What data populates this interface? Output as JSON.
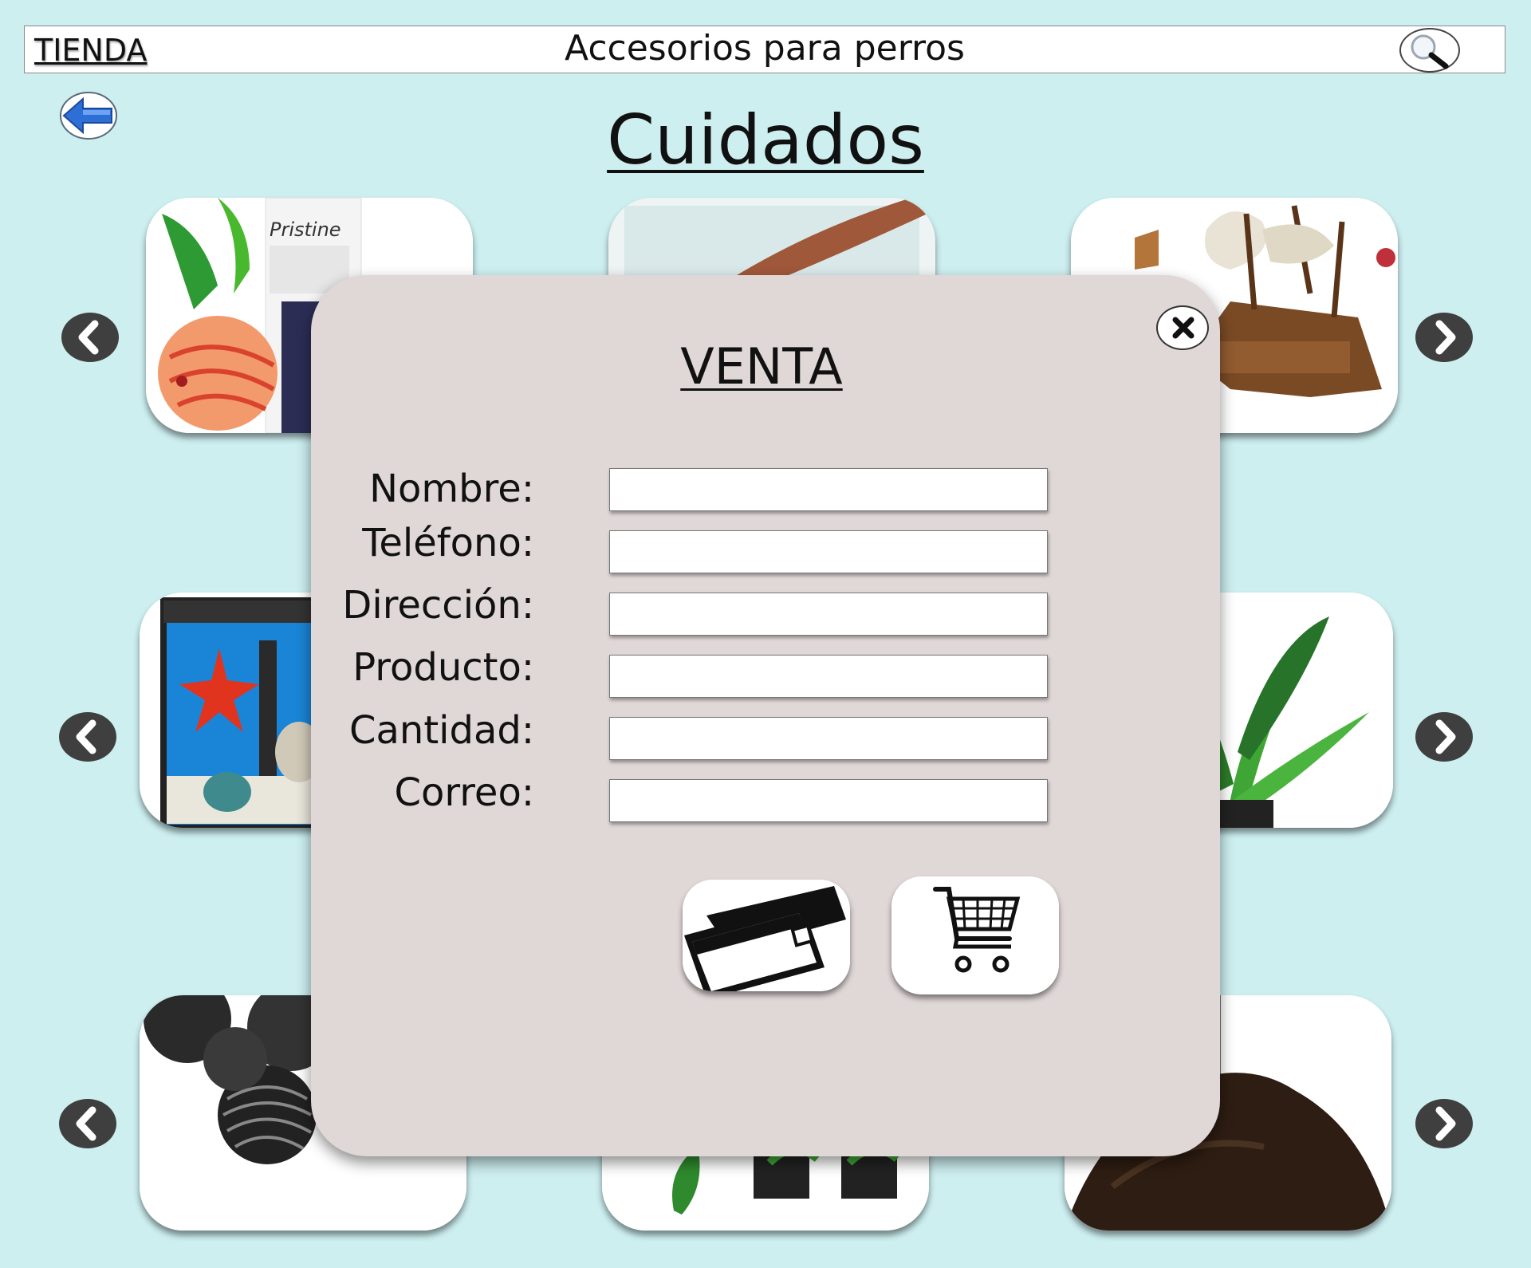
{
  "topbar": {
    "brand": "TIENDA",
    "title": "Accesorios para perros",
    "search_icon": "search-icon"
  },
  "page": {
    "title": "Cuidados",
    "back_icon": "arrow-left-icon"
  },
  "products": [
    {
      "image": "fish-food-pristine-image",
      "label": "Pristine"
    },
    {
      "image": "aquarium-water-image"
    },
    {
      "image": "shipwreck-decoration-image"
    },
    {
      "image": "aquarium-tank-image"
    },
    {
      "image": "aquatic-plant-image"
    },
    {
      "image": "bio-balls-image"
    },
    {
      "image": "aquatic-plants-pot-image"
    },
    {
      "image": "substrate-soil-image"
    }
  ],
  "modal": {
    "title": "VENTA",
    "close_icon": "close-icon",
    "fields": [
      {
        "label": "Nombre:",
        "value": "",
        "placeholder": ""
      },
      {
        "label": "Teléfono:",
        "value": "",
        "placeholder": ""
      },
      {
        "label": "Dirección:",
        "value": "",
        "placeholder": ""
      },
      {
        "label": "Producto:",
        "value": "",
        "placeholder": ""
      },
      {
        "label": "Cantidad:",
        "value": "",
        "placeholder": ""
      },
      {
        "label": "Correo:",
        "value": "",
        "placeholder": ""
      }
    ],
    "actions": [
      {
        "icon": "credit-card-icon"
      },
      {
        "icon": "shopping-cart-icon"
      }
    ]
  },
  "colors": {
    "background": "#cdeff0",
    "modal": "#e0d7d7",
    "arrow": "#3f3f3f"
  }
}
